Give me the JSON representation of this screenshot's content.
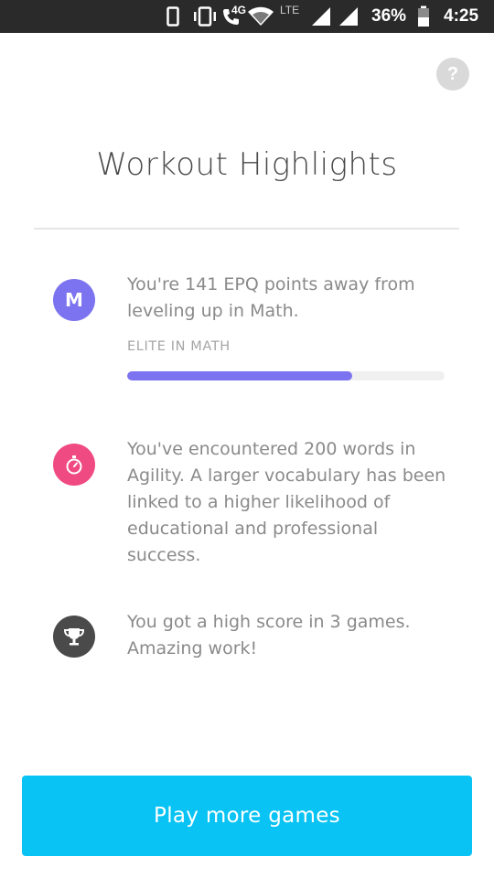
{
  "status_bar": {
    "network_4g": "4G",
    "network_lte": "LTE",
    "battery_percent": "36%",
    "time": "4:25",
    "icons": [
      "phone-outline-icon",
      "vibrate-icon",
      "wifi-call-icon",
      "wifi-icon",
      "signal-icon",
      "signal-icon",
      "battery-icon"
    ]
  },
  "help": {
    "label": "?"
  },
  "header": {
    "title": "Workout Highlights"
  },
  "highlights": [
    {
      "icon": "math-letter-icon",
      "icon_letter": "M",
      "icon_color": "#7b73ef",
      "text": "You're 141 EPQ points away from leveling up in Math.",
      "sub_label": "ELITE IN MATH",
      "progress_fraction": 0.71
    },
    {
      "icon": "stopwatch-icon",
      "icon_color": "#ef4a82",
      "text": "You've encountered 200 words in Agility. A larger vocabulary has been linked to a higher likelihood of educational and professional success."
    },
    {
      "icon": "trophy-icon",
      "icon_color": "#4a4a4a",
      "text": "You got a high score in 3 games. Amazing work!"
    }
  ],
  "cta": {
    "label": "Play more games",
    "color": "#08c3f3"
  }
}
